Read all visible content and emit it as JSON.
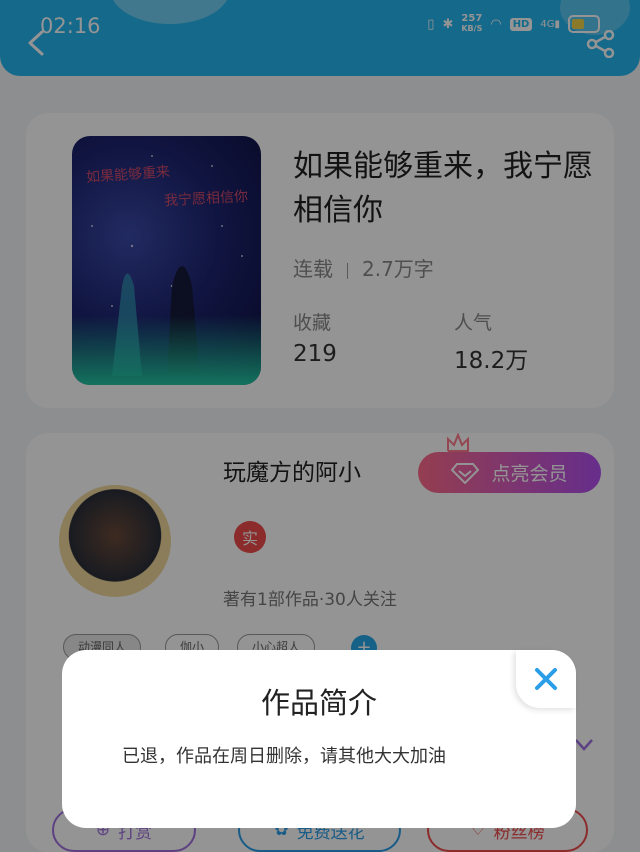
{
  "status_bar": {
    "time": "02:16",
    "speed_value": "257",
    "speed_unit": "KB/S",
    "hd_label": "HD",
    "network": "4G"
  },
  "book": {
    "title": "如果能够重来，我宁愿相信你",
    "cover_line1": "如果能够重来",
    "cover_line2": "我宁愿相信你",
    "status": "连载",
    "word_count": "2.7万字",
    "favorites_label": "收藏",
    "favorites_value": "219",
    "popularity_label": "人气",
    "popularity_value": "18.2万"
  },
  "author": {
    "name": "玩魔方的阿小",
    "vip_button": "点亮会员",
    "real_badge": "实",
    "stats": "著有1部作品·30人关注",
    "tags": [
      "动漫同人",
      "伽小",
      "小心超人"
    ],
    "tag_add": "+"
  },
  "actions": {
    "reward": "打赏",
    "free_gift": "免费送花",
    "fan_rank": "粉丝榜"
  },
  "dialog": {
    "title": "作品简介",
    "text": "已退，作品在周日删除，请其他大大加油",
    "close_icon": "close-icon"
  },
  "colors": {
    "header": "#25b5ee",
    "vip_gradient_start": "#ff6b8a",
    "vip_gradient_end": "#b04ff0",
    "badge_red": "#f04a4a",
    "close_blue": "#2a9ee8"
  }
}
